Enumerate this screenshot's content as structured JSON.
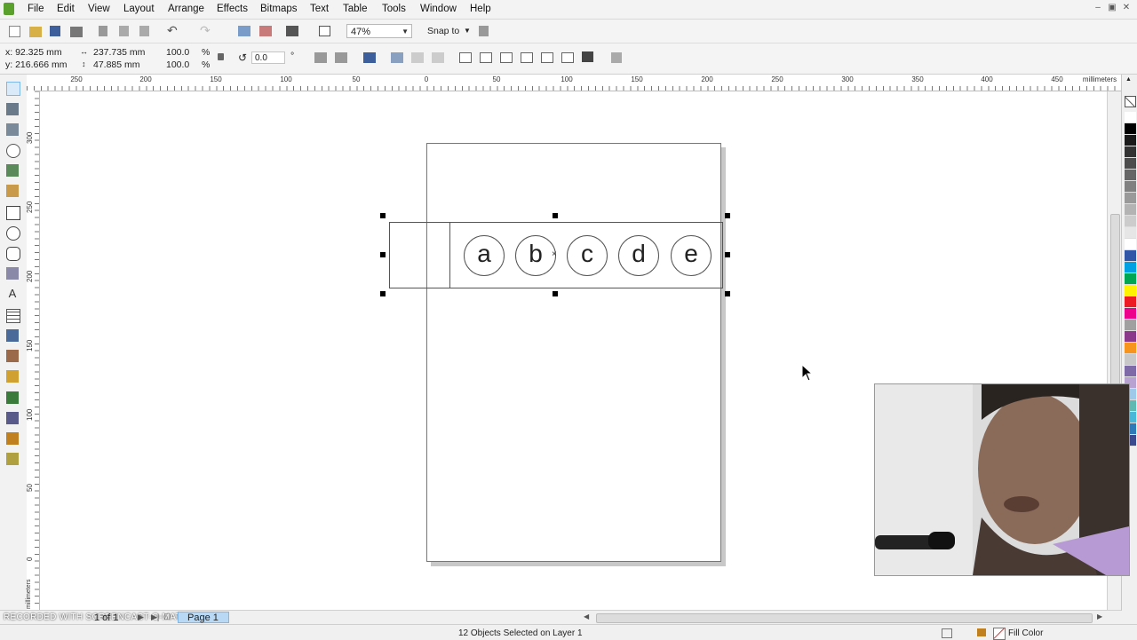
{
  "menubar": {
    "items": [
      "File",
      "Edit",
      "View",
      "Layout",
      "Arrange",
      "Effects",
      "Bitmaps",
      "Text",
      "Table",
      "Tools",
      "Window",
      "Help"
    ]
  },
  "standard_toolbar": {
    "zoom_value": "47%",
    "snap_to_label": "Snap to"
  },
  "property_bar": {
    "x_value": "x: 92.325 mm",
    "y_value": "y: 216.666 mm",
    "width_value": "237.735 mm",
    "height_value": "47.885 mm",
    "scale_x": "100.0",
    "scale_y": "100.0",
    "scale_unit_x": "%",
    "scale_unit_y": "%",
    "rotation_value": "0.0",
    "rotation_unit": "°"
  },
  "rulers": {
    "unit_label": "millimeters",
    "horizontal_ticks": [
      "250",
      "200",
      "150",
      "100",
      "50",
      "0",
      "50",
      "100",
      "150",
      "200",
      "250",
      "300",
      "350",
      "400",
      "450"
    ],
    "vertical_ticks": [
      "300",
      "250",
      "200",
      "150",
      "100",
      "50",
      "0"
    ],
    "vertical_unit": "millimeters"
  },
  "canvas": {
    "circles": [
      "a",
      "b",
      "c",
      "d",
      "e"
    ]
  },
  "page_navigator": {
    "count_text": "1 of 1",
    "page_tab": "Page 1"
  },
  "status": {
    "selection_text": "12 Objects Selected on Layer 1",
    "fill_label": "Fill Color"
  },
  "watermark": {
    "text": "RECORDED WITH SCREENCAST-O-MATIC"
  },
  "colors": {
    "accent": "#7fb7e8",
    "page_tab_bg": "#b8d8f4",
    "palette": [
      "#ffffff",
      "#000000",
      "#1a1a1a",
      "#333333",
      "#4d4d4d",
      "#666666",
      "#808080",
      "#999999",
      "#b3b3b3",
      "#cccccc",
      "#e6e6e6",
      "#ffffff",
      "#3056a8",
      "#00a0e3",
      "#00a651",
      "#fff200",
      "#ed1c24",
      "#ec008c",
      "#a0a0a0",
      "#8b3a8b",
      "#f7941d",
      "#c8c8c8",
      "#7f6aa8",
      "#b7a2d2",
      "#9fc9e8",
      "#5fb8b2",
      "#4ab6d8",
      "#2e7ab8",
      "#3b4a8f"
    ]
  }
}
